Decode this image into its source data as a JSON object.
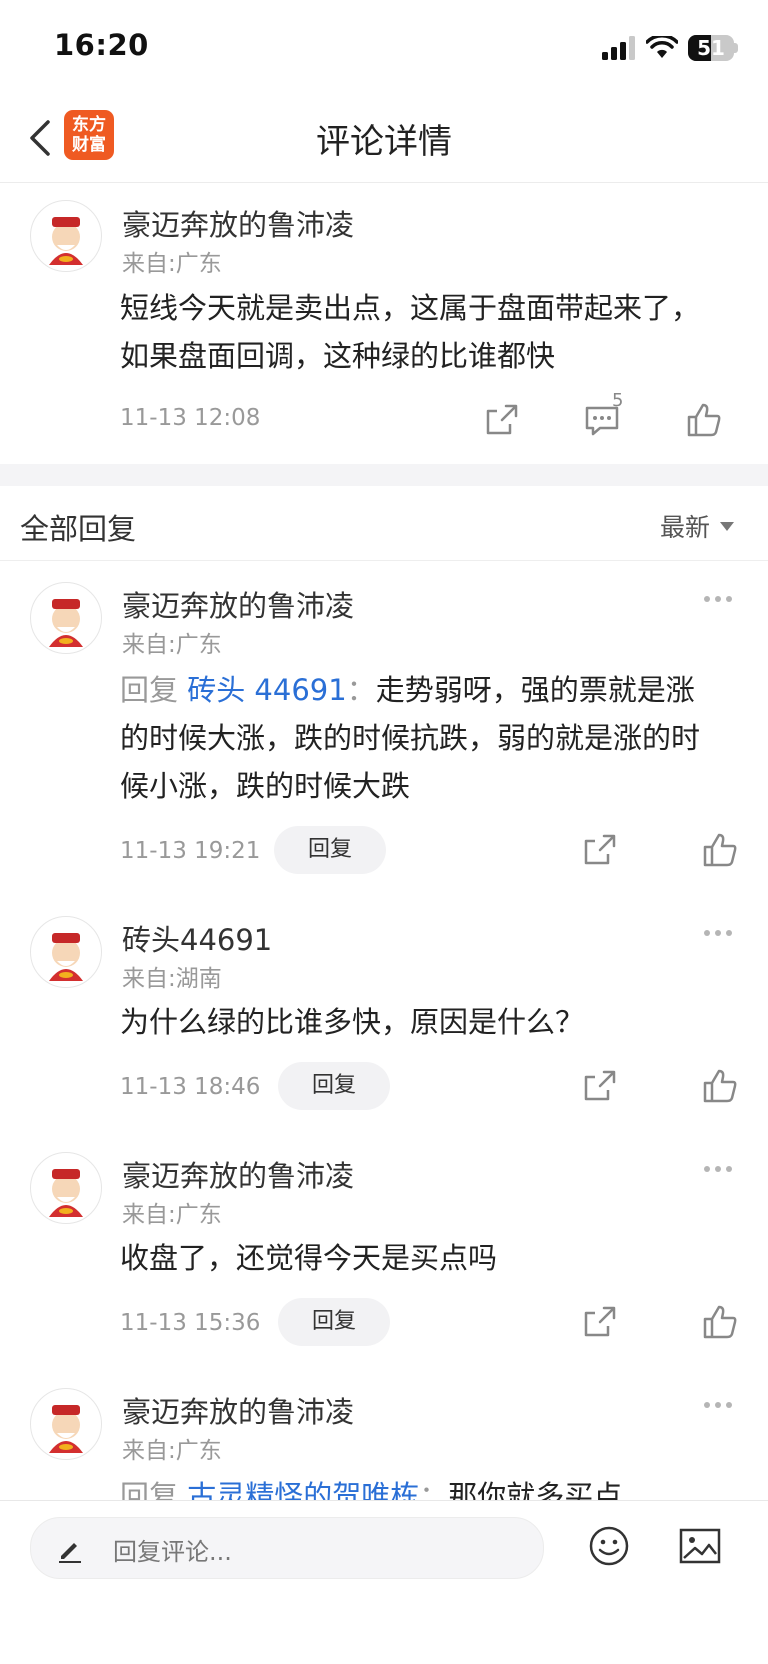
{
  "status_bar": {
    "time": "16:20",
    "battery": "51",
    "battery_level": 0.51
  },
  "nav": {
    "title": "评论详情",
    "logo_line1": "东方",
    "logo_line2": "财富"
  },
  "main_comment": {
    "username": "豪迈奔放的鲁沛凌",
    "region": "来自:广东",
    "content_line1": "短线今天就是卖出点，这属于盘面带起来了，",
    "content_line2": "如果盘面回调，这种绿的比谁都快",
    "time": "11-13 12:08",
    "reply_count": "5"
  },
  "replies_section": {
    "title": "全部回复",
    "sort": "最新"
  },
  "replies": [
    {
      "username": "豪迈奔放的鲁沛凌",
      "region": "来自:广东",
      "prefix": "回复 ",
      "target": "砖头 44691",
      "colon": "：",
      "line1": "走势弱呀，强的票就是涨",
      "line2": "的时候大涨，跌的时候抗跌，弱的就是涨的时",
      "line3": "候小涨，跌的时候大跌",
      "time": "11-13 19:21",
      "reply_label": "回复"
    },
    {
      "username": "砖头44691",
      "region": "来自:湖南",
      "line1": "为什么绿的比谁多快，原因是什么？",
      "time": "11-13 18:46",
      "reply_label": "回复"
    },
    {
      "username": "豪迈奔放的鲁沛凌",
      "region": "来自:广东",
      "line1": "收盘了，还觉得今天是买点吗",
      "time": "11-13 15:36",
      "reply_label": "回复"
    },
    {
      "username": "豪迈奔放的鲁沛凌",
      "region": "来自:广东",
      "prefix": "回复 ",
      "target": "古灵精怪的贺唯栋",
      "colon": "：",
      "line1": "那你就多买点"
    }
  ],
  "bottom_bar": {
    "placeholder": "回复评论..."
  },
  "colors": {
    "brand": "#ef5a22",
    "link": "#2a6fd6",
    "muted": "#999999"
  }
}
